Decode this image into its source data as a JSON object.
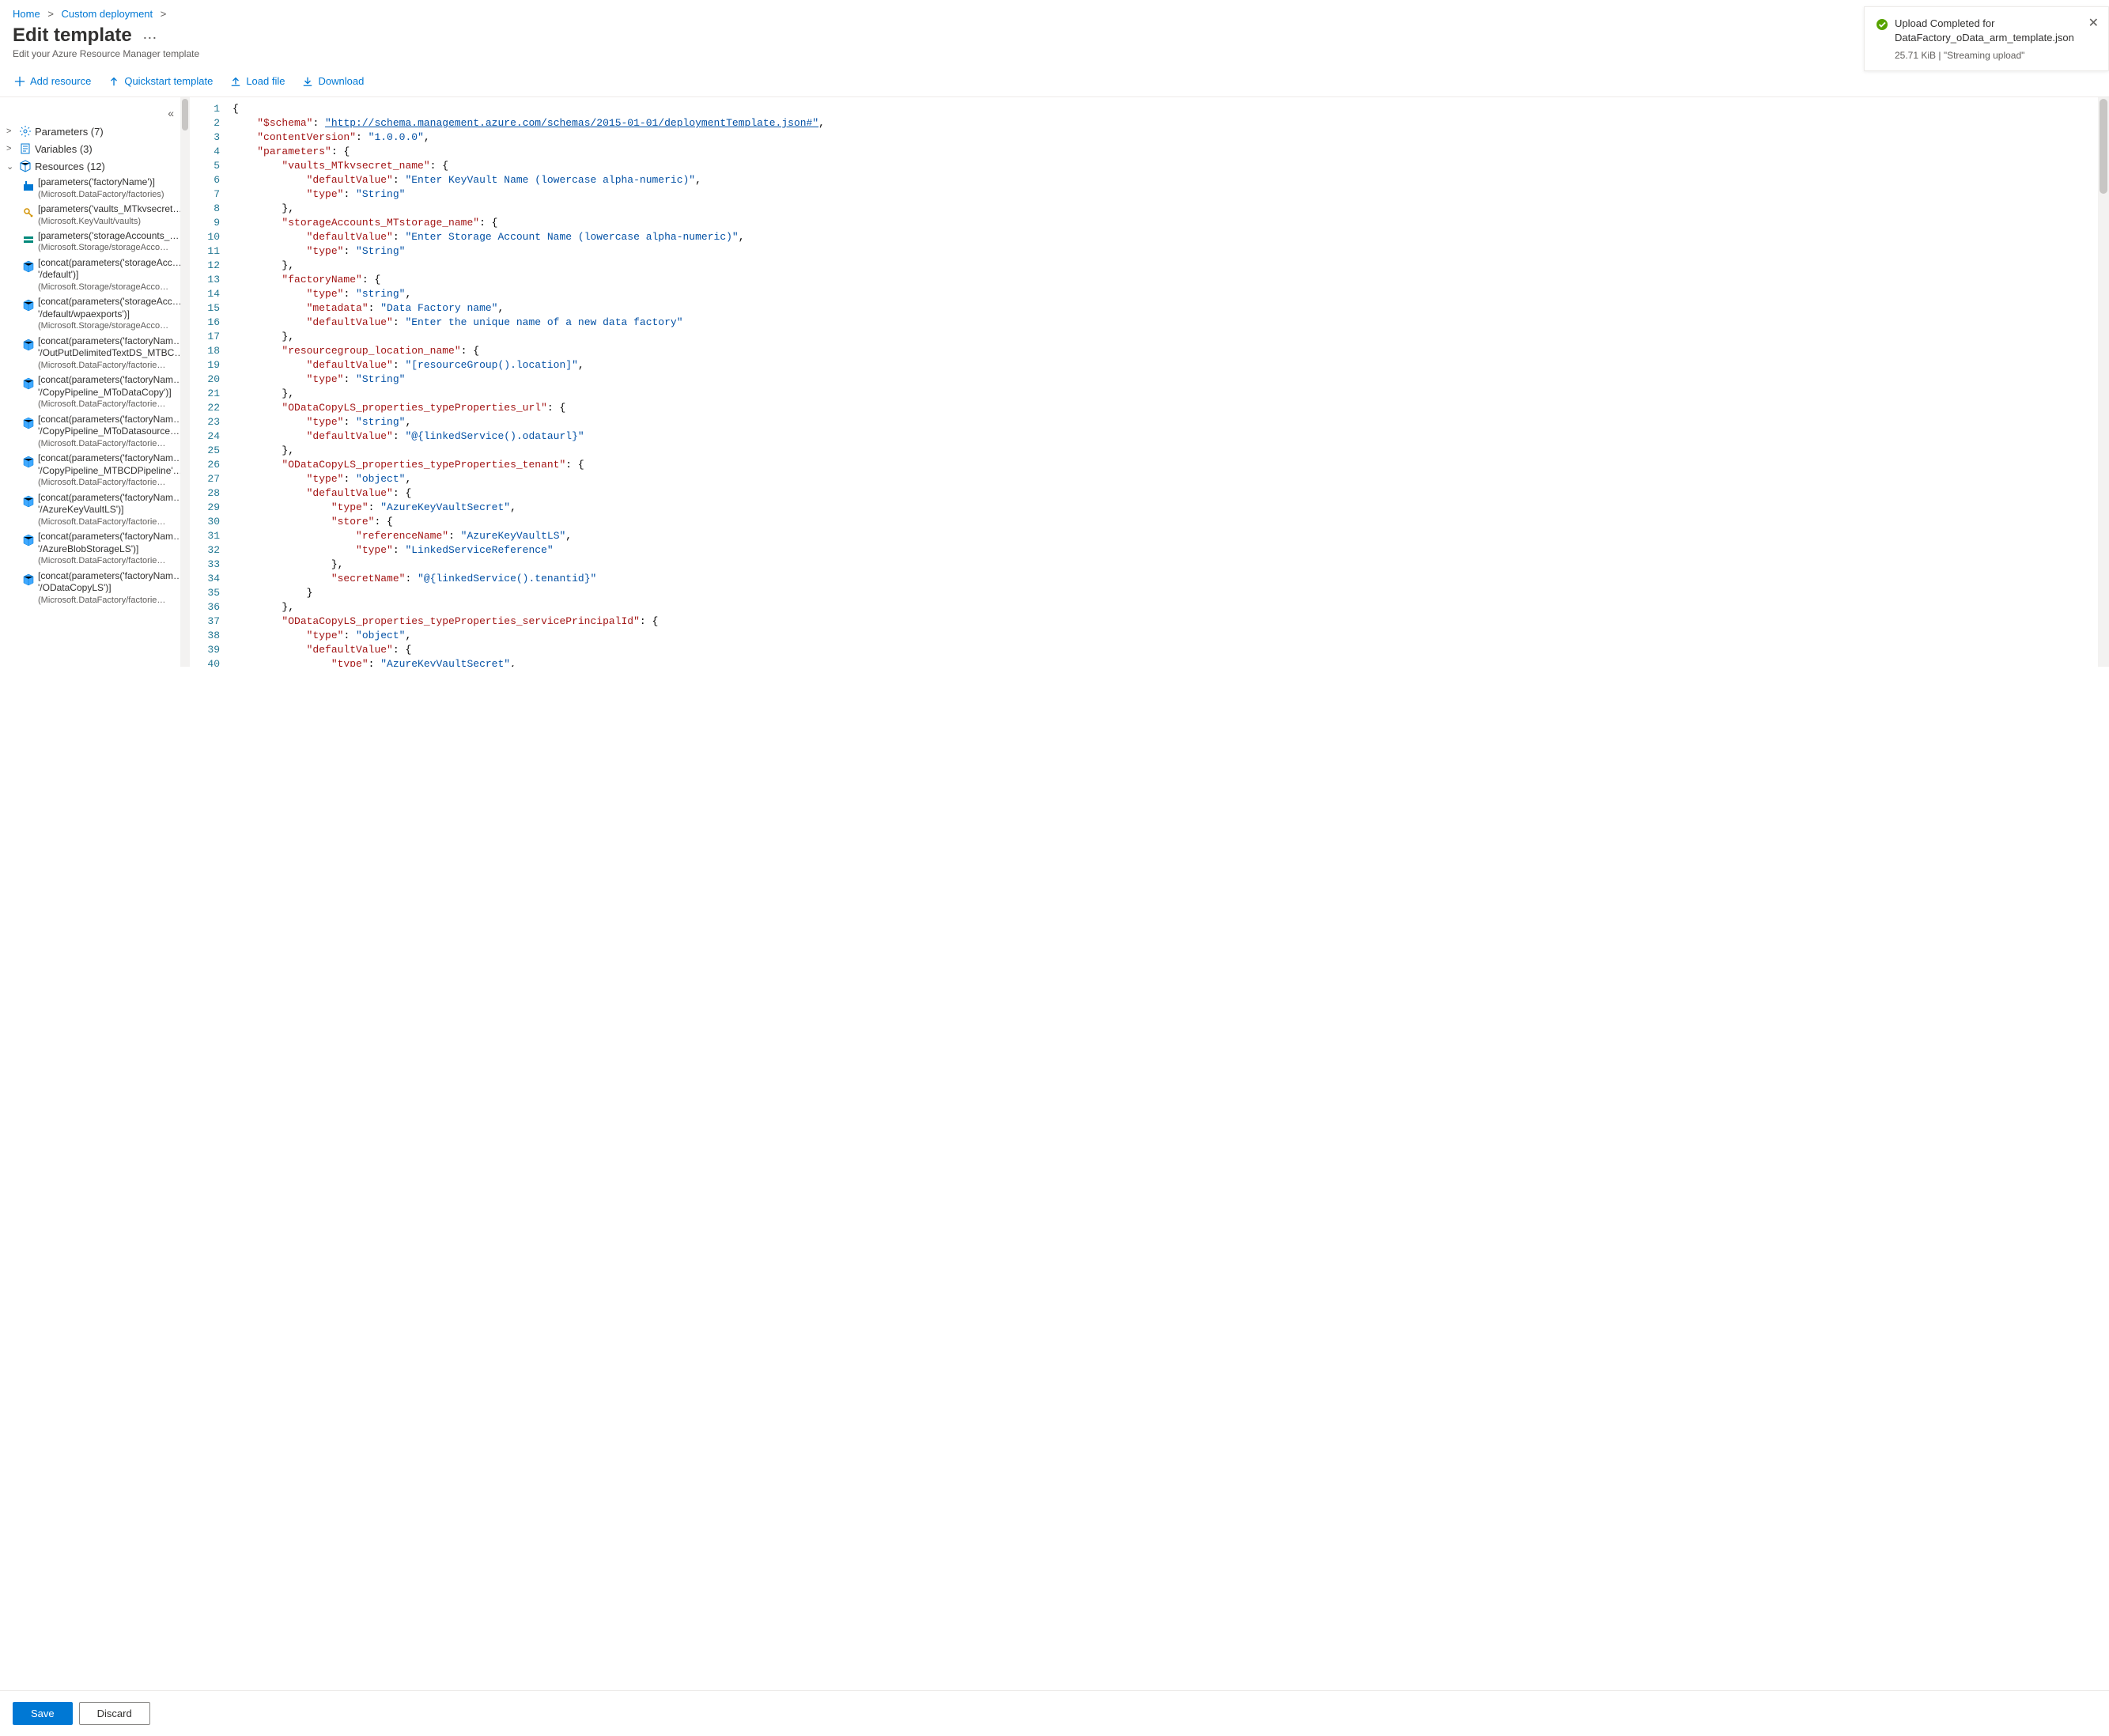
{
  "breadcrumb": [
    {
      "label": "Home"
    },
    {
      "label": "Custom deployment"
    }
  ],
  "header": {
    "title": "Edit template",
    "subtitle": "Edit your Azure Resource Manager template"
  },
  "toolbar": {
    "add": "Add resource",
    "quickstart": "Quickstart template",
    "load": "Load file",
    "download": "Download"
  },
  "notification": {
    "title": "Upload Completed for DataFactory_oData_arm_template.json",
    "subtitle": "25.71 KiB | \"Streaming upload\""
  },
  "tree": {
    "parameters": {
      "label": "Parameters (7)"
    },
    "variables": {
      "label": "Variables (3)"
    },
    "resources": {
      "label": "Resources (12)"
    },
    "items": [
      {
        "title": "[parameters('factoryName')]",
        "sub": "(Microsoft.DataFactory/factories)",
        "icon": "factory"
      },
      {
        "title": "[parameters('vaults_MTkvsecret…",
        "sub": "(Microsoft.KeyVault/vaults)",
        "icon": "keyvault"
      },
      {
        "title": "[parameters('storageAccounts_…",
        "sub": "(Microsoft.Storage/storageAcco…",
        "icon": "storage"
      },
      {
        "title": "[concat(parameters('storageAcc…",
        "sub2": "'/default')]",
        "sub": "(Microsoft.Storage/storageAcco…",
        "icon": "cube"
      },
      {
        "title": "[concat(parameters('storageAcc…",
        "sub2": "'/default/wpaexports')]",
        "sub": "(Microsoft.Storage/storageAcco…",
        "icon": "cube"
      },
      {
        "title": "[concat(parameters('factoryNam…",
        "sub2": "'/OutPutDelimitedTextDS_MTBC…",
        "sub": "(Microsoft.DataFactory/factorie…",
        "icon": "cube"
      },
      {
        "title": "[concat(parameters('factoryNam…",
        "sub2": "'/CopyPipeline_MToDataCopy')]",
        "sub": "(Microsoft.DataFactory/factorie…",
        "icon": "cube"
      },
      {
        "title": "[concat(parameters('factoryNam…",
        "sub2": "'/CopyPipeline_MToDatasource…",
        "sub": "(Microsoft.DataFactory/factorie…",
        "icon": "cube"
      },
      {
        "title": "[concat(parameters('factoryNam…",
        "sub2": "'/CopyPipeline_MTBCDPipeline'…",
        "sub": "(Microsoft.DataFactory/factorie…",
        "icon": "cube"
      },
      {
        "title": "[concat(parameters('factoryNam…",
        "sub2": "'/AzureKeyVaultLS')]",
        "sub": "(Microsoft.DataFactory/factorie…",
        "icon": "cube"
      },
      {
        "title": "[concat(parameters('factoryNam…",
        "sub2": "'/AzureBlobStorageLS')]",
        "sub": "(Microsoft.DataFactory/factorie…",
        "icon": "cube"
      },
      {
        "title": "[concat(parameters('factoryNam…",
        "sub2": "'/ODataCopyLS')]",
        "sub": "(Microsoft.DataFactory/factorie…",
        "icon": "cube"
      }
    ]
  },
  "code": [
    [
      [
        "brace",
        "{"
      ]
    ],
    [
      [
        "sp",
        "    "
      ],
      [
        "key",
        "\"$schema\""
      ],
      [
        "punc",
        ": "
      ],
      [
        "link",
        "\"http://schema.management.azure.com/schemas/2015-01-01/deploymentTemplate.json#\""
      ],
      [
        "punc",
        ","
      ]
    ],
    [
      [
        "sp",
        "    "
      ],
      [
        "key",
        "\"contentVersion\""
      ],
      [
        "punc",
        ": "
      ],
      [
        "str",
        "\"1.0.0.0\""
      ],
      [
        "punc",
        ","
      ]
    ],
    [
      [
        "sp",
        "    "
      ],
      [
        "key",
        "\"parameters\""
      ],
      [
        "punc",
        ": {"
      ]
    ],
    [
      [
        "sp",
        "        "
      ],
      [
        "key",
        "\"vaults_MTkvsecret_name\""
      ],
      [
        "punc",
        ": {"
      ]
    ],
    [
      [
        "sp",
        "            "
      ],
      [
        "key",
        "\"defaultValue\""
      ],
      [
        "punc",
        ": "
      ],
      [
        "str",
        "\"Enter KeyVault Name (lowercase alpha-numeric)\""
      ],
      [
        "punc",
        ","
      ]
    ],
    [
      [
        "sp",
        "            "
      ],
      [
        "key",
        "\"type\""
      ],
      [
        "punc",
        ": "
      ],
      [
        "str",
        "\"String\""
      ]
    ],
    [
      [
        "sp",
        "        "
      ],
      [
        "punc",
        "},"
      ]
    ],
    [
      [
        "sp",
        "        "
      ],
      [
        "key",
        "\"storageAccounts_MTstorage_name\""
      ],
      [
        "punc",
        ": {"
      ]
    ],
    [
      [
        "sp",
        "            "
      ],
      [
        "key",
        "\"defaultValue\""
      ],
      [
        "punc",
        ": "
      ],
      [
        "str",
        "\"Enter Storage Account Name (lowercase alpha-numeric)\""
      ],
      [
        "punc",
        ","
      ]
    ],
    [
      [
        "sp",
        "            "
      ],
      [
        "key",
        "\"type\""
      ],
      [
        "punc",
        ": "
      ],
      [
        "str",
        "\"String\""
      ]
    ],
    [
      [
        "sp",
        "        "
      ],
      [
        "punc",
        "},"
      ]
    ],
    [
      [
        "sp",
        "        "
      ],
      [
        "key",
        "\"factoryName\""
      ],
      [
        "punc",
        ": {"
      ]
    ],
    [
      [
        "sp",
        "            "
      ],
      [
        "key",
        "\"type\""
      ],
      [
        "punc",
        ": "
      ],
      [
        "str",
        "\"string\""
      ],
      [
        "punc",
        ","
      ]
    ],
    [
      [
        "sp",
        "            "
      ],
      [
        "key",
        "\"metadata\""
      ],
      [
        "punc",
        ": "
      ],
      [
        "str",
        "\"Data Factory name\""
      ],
      [
        "punc",
        ","
      ]
    ],
    [
      [
        "sp",
        "            "
      ],
      [
        "key",
        "\"defaultValue\""
      ],
      [
        "punc",
        ": "
      ],
      [
        "str",
        "\"Enter the unique name of a new data factory\""
      ]
    ],
    [
      [
        "sp",
        "        "
      ],
      [
        "punc",
        "},"
      ]
    ],
    [
      [
        "sp",
        "        "
      ],
      [
        "key",
        "\"resourcegroup_location_name\""
      ],
      [
        "punc",
        ": {"
      ]
    ],
    [
      [
        "sp",
        "            "
      ],
      [
        "key",
        "\"defaultValue\""
      ],
      [
        "punc",
        ": "
      ],
      [
        "str",
        "\"[resourceGroup().location]\""
      ],
      [
        "punc",
        ","
      ]
    ],
    [
      [
        "sp",
        "            "
      ],
      [
        "key",
        "\"type\""
      ],
      [
        "punc",
        ": "
      ],
      [
        "str",
        "\"String\""
      ]
    ],
    [
      [
        "sp",
        "        "
      ],
      [
        "punc",
        "},"
      ]
    ],
    [
      [
        "sp",
        "        "
      ],
      [
        "key",
        "\"ODataCopyLS_properties_typeProperties_url\""
      ],
      [
        "punc",
        ": {"
      ]
    ],
    [
      [
        "sp",
        "            "
      ],
      [
        "key",
        "\"type\""
      ],
      [
        "punc",
        ": "
      ],
      [
        "str",
        "\"string\""
      ],
      [
        "punc",
        ","
      ]
    ],
    [
      [
        "sp",
        "            "
      ],
      [
        "key",
        "\"defaultValue\""
      ],
      [
        "punc",
        ": "
      ],
      [
        "str",
        "\"@{linkedService().odataurl}\""
      ]
    ],
    [
      [
        "sp",
        "        "
      ],
      [
        "punc",
        "},"
      ]
    ],
    [
      [
        "sp",
        "        "
      ],
      [
        "key",
        "\"ODataCopyLS_properties_typeProperties_tenant\""
      ],
      [
        "punc",
        ": {"
      ]
    ],
    [
      [
        "sp",
        "            "
      ],
      [
        "key",
        "\"type\""
      ],
      [
        "punc",
        ": "
      ],
      [
        "str",
        "\"object\""
      ],
      [
        "punc",
        ","
      ]
    ],
    [
      [
        "sp",
        "            "
      ],
      [
        "key",
        "\"defaultValue\""
      ],
      [
        "punc",
        ": {"
      ]
    ],
    [
      [
        "sp",
        "                "
      ],
      [
        "key",
        "\"type\""
      ],
      [
        "punc",
        ": "
      ],
      [
        "str",
        "\"AzureKeyVaultSecret\""
      ],
      [
        "punc",
        ","
      ]
    ],
    [
      [
        "sp",
        "                "
      ],
      [
        "key",
        "\"store\""
      ],
      [
        "punc",
        ": {"
      ]
    ],
    [
      [
        "sp",
        "                    "
      ],
      [
        "key",
        "\"referenceName\""
      ],
      [
        "punc",
        ": "
      ],
      [
        "str",
        "\"AzureKeyVaultLS\""
      ],
      [
        "punc",
        ","
      ]
    ],
    [
      [
        "sp",
        "                    "
      ],
      [
        "key",
        "\"type\""
      ],
      [
        "punc",
        ": "
      ],
      [
        "str",
        "\"LinkedServiceReference\""
      ]
    ],
    [
      [
        "sp",
        "                "
      ],
      [
        "punc",
        "},"
      ]
    ],
    [
      [
        "sp",
        "                "
      ],
      [
        "key",
        "\"secretName\""
      ],
      [
        "punc",
        ": "
      ],
      [
        "str",
        "\"@{linkedService().tenantid}\""
      ]
    ],
    [
      [
        "sp",
        "            "
      ],
      [
        "punc",
        "}"
      ]
    ],
    [
      [
        "sp",
        "        "
      ],
      [
        "punc",
        "},"
      ]
    ],
    [
      [
        "sp",
        "        "
      ],
      [
        "key",
        "\"ODataCopyLS_properties_typeProperties_servicePrincipalId\""
      ],
      [
        "punc",
        ": {"
      ]
    ],
    [
      [
        "sp",
        "            "
      ],
      [
        "key",
        "\"type\""
      ],
      [
        "punc",
        ": "
      ],
      [
        "str",
        "\"object\""
      ],
      [
        "punc",
        ","
      ]
    ],
    [
      [
        "sp",
        "            "
      ],
      [
        "key",
        "\"defaultValue\""
      ],
      [
        "punc",
        ": {"
      ]
    ],
    [
      [
        "sp",
        "                "
      ],
      [
        "key",
        "\"type\""
      ],
      [
        "punc",
        ": "
      ],
      [
        "str",
        "\"AzureKeyVaultSecret\""
      ],
      [
        "punc",
        ","
      ]
    ]
  ],
  "footer": {
    "save": "Save",
    "discard": "Discard"
  }
}
